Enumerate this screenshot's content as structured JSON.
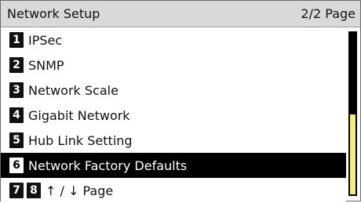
{
  "header": {
    "title": "Network Setup",
    "page_indicator": "2/2 Page"
  },
  "menu": {
    "items": [
      {
        "number": "1",
        "label": "IPSec"
      },
      {
        "number": "2",
        "label": "SNMP"
      },
      {
        "number": "3",
        "label": "Network Scale"
      },
      {
        "number": "4",
        "label": "Gigabit Network"
      },
      {
        "number": "5",
        "label": "Hub Link Setting"
      },
      {
        "number": "6",
        "label": "Network Factory Defaults",
        "selected": true
      }
    ],
    "nav": {
      "key_a": "7",
      "key_b": "8",
      "label": "↑ / ↓ Page"
    }
  },
  "scrollbar": {
    "position_fraction": 0.5,
    "visible_fraction": 0.5,
    "thumb_color": "#f4ed80"
  },
  "colors": {
    "selected_bg": "#000000",
    "header_bg": "#d9d9d9"
  }
}
